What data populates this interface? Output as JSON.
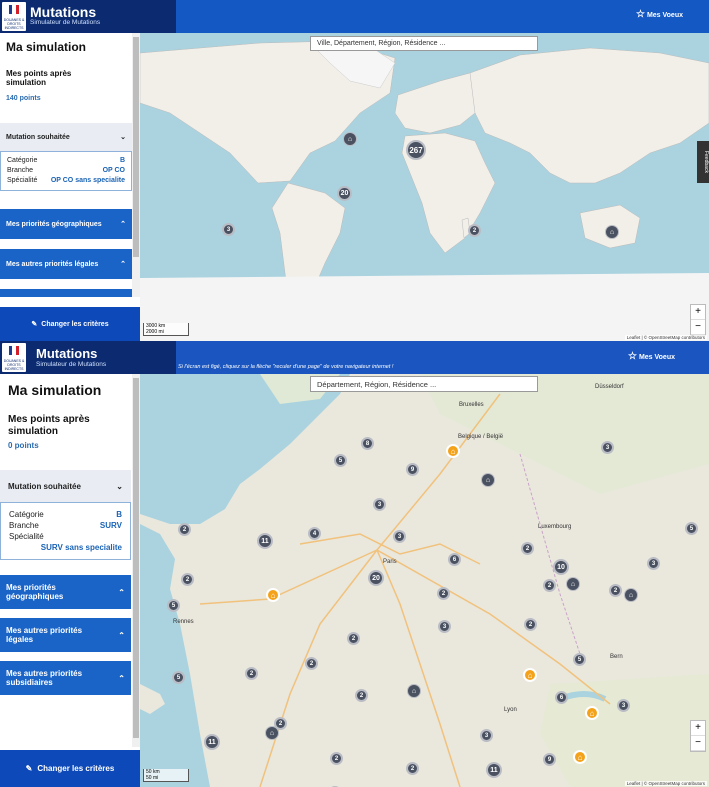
{
  "brand": {
    "logo_text": "DOUANES & DROITS INDIRECTS",
    "app_title": "Mutations",
    "app_subtitle": "Simulateur de Mutations",
    "voeux_label": "Mes Voeux",
    "banner_message": "Si l'écran est figé, cliquez sur la flèche \"reculer d'une page\" de votre navigateur internet !"
  },
  "view1": {
    "sim_title": "Ma simulation",
    "points_title": "Mes points après simulation",
    "points_value": "140 points",
    "mutation_label": "Mutation souhaitée",
    "criteria": {
      "categorie_label": "Catégorie",
      "categorie_value": "B",
      "branche_label": "Branche",
      "branche_value": "OP CO",
      "specialite_label": "Spécialité",
      "specialite_value": "OP CO sans specialite"
    },
    "geo_label": "Mes priorités géographiques",
    "legal_label": "Mes autres priorités légales",
    "change_btn": "Changer les critères",
    "search_placeholder": "Ville, Département, Région, Résidence ...",
    "clusters": [
      "267",
      "20",
      "3",
      "2"
    ],
    "scale": [
      "3000 km",
      "2000 mi"
    ],
    "attribution": "Leaflet | © OpenStreetMap contributors",
    "feedback": "Feedback",
    "zoom_in": "+",
    "zoom_out": "−"
  },
  "view2": {
    "sim_title": "Ma simulation",
    "points_title": "Mes points après simulation",
    "points_value": "0 points",
    "mutation_label": "Mutation souhaitée",
    "criteria": {
      "categorie_label": "Catégorie",
      "categorie_value": "B",
      "branche_label": "Branche",
      "branche_value": "SURV",
      "specialite_label": "Spécialité",
      "specialite_value": "SURV sans specialite"
    },
    "geo_label": "Mes priorités géographiques",
    "legal_label": "Mes autres priorités légales",
    "subsid_label": "Mes autres priorités subsidiaires",
    "change_btn": "Changer les critères",
    "search_placeholder": "Département, Région, Résidence ...",
    "clusters": [
      "8",
      "5",
      "9",
      "3",
      "2",
      "4",
      "11",
      "3",
      "6",
      "2",
      "10",
      "2",
      "20",
      "2",
      "5",
      "2",
      "3",
      "2",
      "5",
      "2",
      "2",
      "2",
      "5",
      "9",
      "11",
      "3",
      "11",
      "2",
      "3",
      "2",
      "2",
      "2",
      "3",
      "5",
      "2",
      "6",
      "3"
    ],
    "scale": [
      "50 km",
      "50 mi"
    ],
    "attribution": "Leaflet | © OpenStreetMap contributors",
    "zoom_in": "+",
    "zoom_out": "−",
    "city_labels": [
      "Bruxelles",
      "Belgique / België",
      "Luxembourg",
      "Düsseldorf",
      "Paris",
      "Rennes",
      "Lyon",
      "Bern"
    ]
  }
}
